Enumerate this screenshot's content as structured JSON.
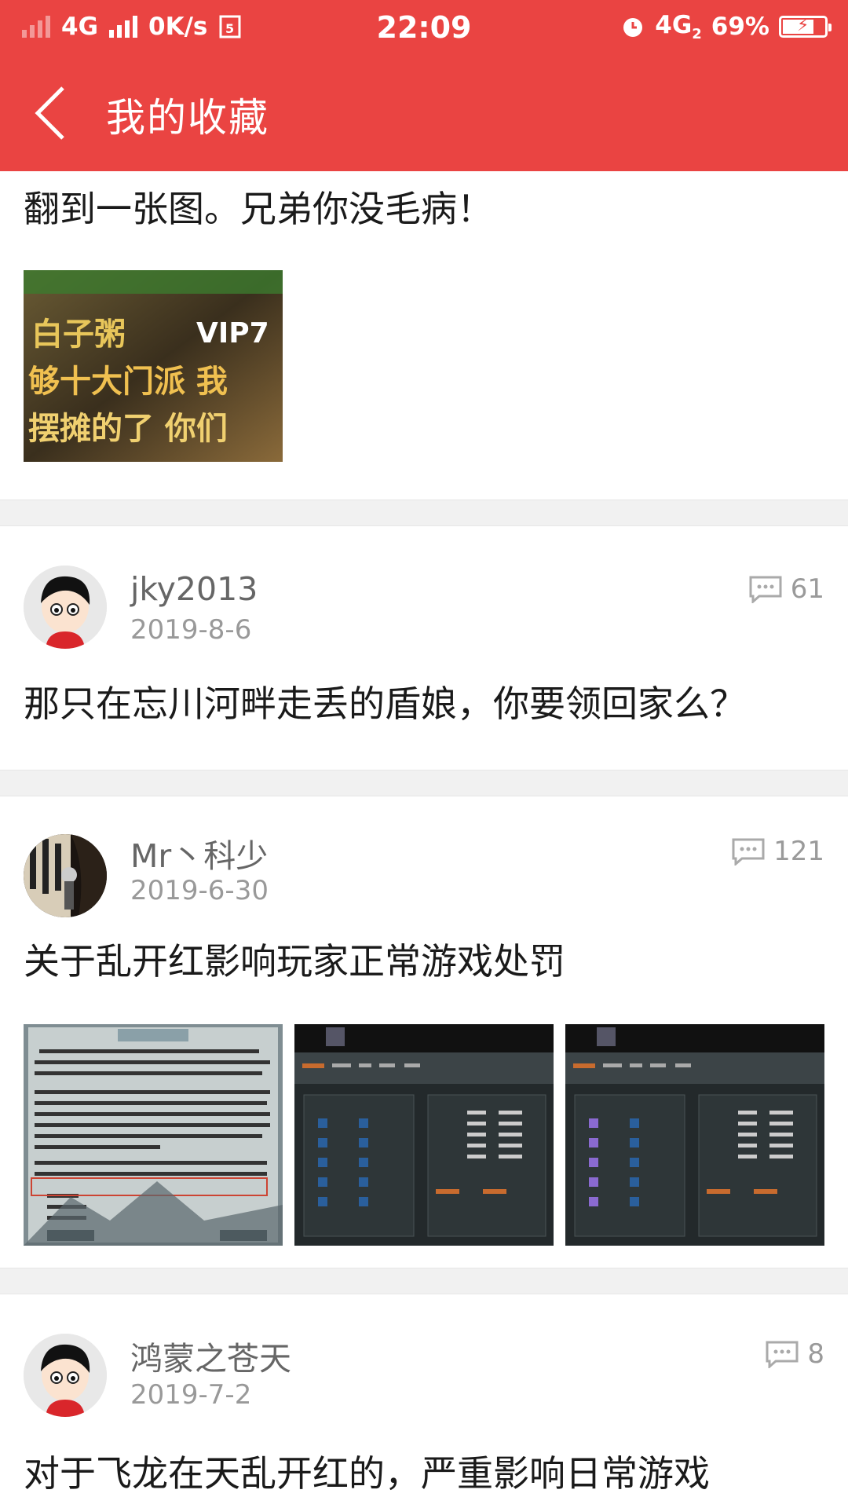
{
  "status_bar": {
    "network_left": "4G",
    "speed": "0K/s",
    "time": "22:09",
    "network_right": "4G",
    "network_right_sub": "2",
    "battery": "69%",
    "battery_level": 0.69
  },
  "app_bar": {
    "title": "我的收藏",
    "back_icon": "back-arrow-icon"
  },
  "posts": [
    {
      "text": "翻到一张图。兄弟你没毛病！"
    },
    {
      "author": "jky2013",
      "date": "2019-8-6",
      "comments": "61",
      "title": "那只在忘川河畔走丢的盾娘，你要领回家么？"
    },
    {
      "author": "Mr丶科少",
      "date": "2019-6-30",
      "comments": "121",
      "title": "关于乱开红影响玩家正常游戏处罚"
    },
    {
      "author": "鸿蒙之苍天",
      "date": "2019-7-2",
      "comments": "8",
      "title": "对于飞龙在天乱开红的，严重影响日常游戏"
    }
  ],
  "colors": {
    "accent": "#ea4442",
    "divider": "#f1f1f1"
  }
}
